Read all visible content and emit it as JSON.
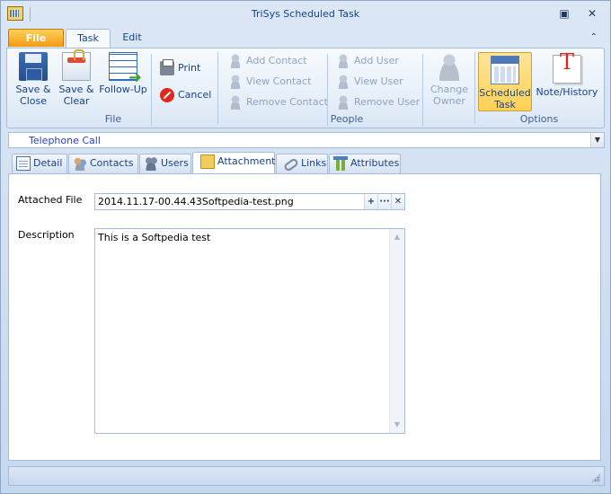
{
  "window": {
    "title": "TriSys Scheduled Task",
    "restore_glyph": "▣",
    "close_glyph": "✕"
  },
  "ribbon": {
    "file_tab": "File",
    "tabs": [
      {
        "label": "Task",
        "active": true
      },
      {
        "label": "Edit",
        "active": false
      }
    ],
    "collapse_glyph": "⌃",
    "groups": {
      "file": {
        "label": "File",
        "save_close": [
          "Save &",
          "Close"
        ],
        "save_clear": [
          "Save &",
          "Clear"
        ],
        "follow_up": "Follow-Up",
        "print": "Print",
        "cancel": "Cancel"
      },
      "people": {
        "label": "People",
        "add_contact": "Add Contact",
        "view_contact": "View Contact",
        "remove_contact": "Remove Contact",
        "add_user": "Add User",
        "view_user": "View User",
        "remove_user": "Remove User",
        "change_owner": [
          "Change",
          "Owner"
        ]
      },
      "options": {
        "label": "Options",
        "scheduled_task": [
          "Scheduled",
          "Task"
        ],
        "note_history": "Note/History"
      }
    }
  },
  "task_type": {
    "value": "Telephone Call",
    "arrow_glyph": "▼"
  },
  "page_tabs": [
    {
      "label": "Detail",
      "active": false
    },
    {
      "label": "Contacts",
      "active": false
    },
    {
      "label": "Users",
      "active": false
    },
    {
      "label": "Attachment",
      "active": true
    },
    {
      "label": "Links",
      "active": false
    },
    {
      "label": "Attributes",
      "active": false
    }
  ],
  "attachment": {
    "file_label": "Attached File",
    "file_value": "2014.11.17-00.44.43Softpedia-test.png",
    "add_glyph": "+",
    "browse_glyph": "···",
    "remove_glyph": "✕",
    "description_label": "Description",
    "description_value": "This is a Softpedia test",
    "scroll_up": "▲",
    "scroll_down": "▼"
  },
  "colors": {
    "accent_file_tab": "#f39a12",
    "selected_button": "#ffd153",
    "disabled_text": "#8da3c3",
    "task_type_text": "#2a3fc8"
  }
}
